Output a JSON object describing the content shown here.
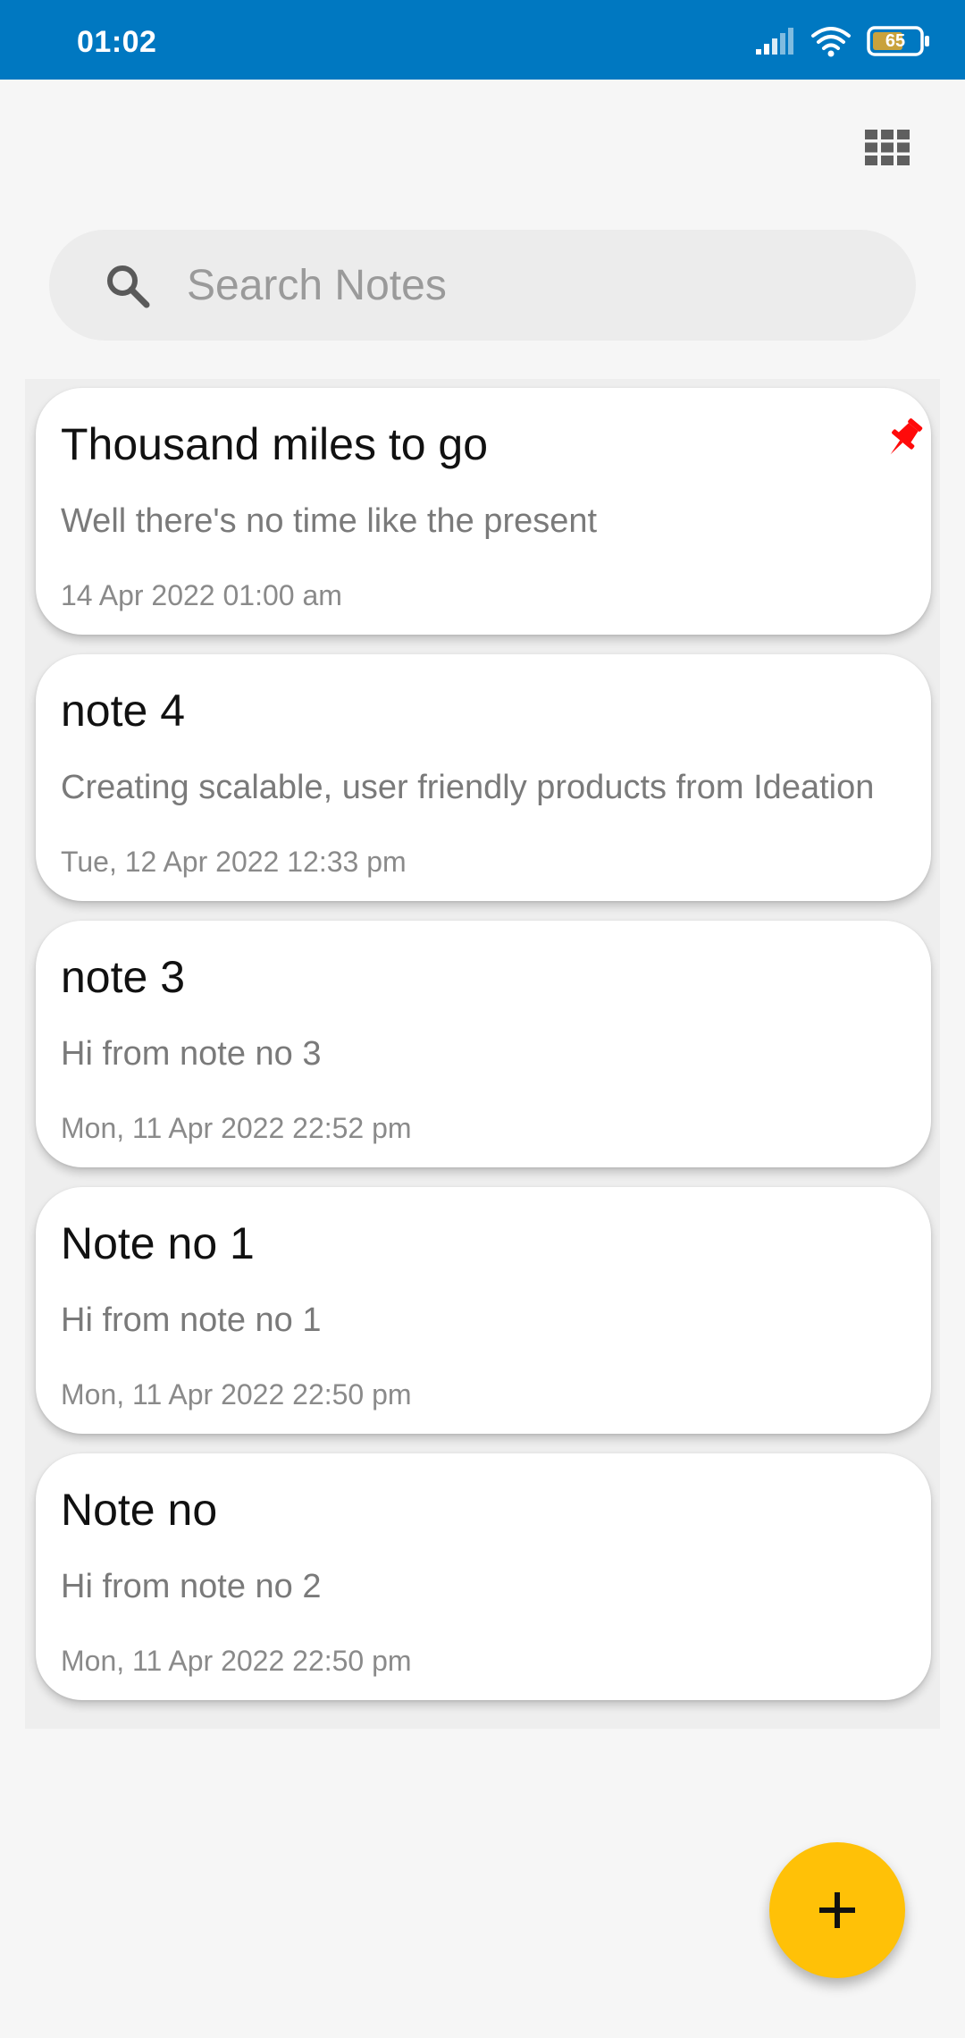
{
  "status_bar": {
    "time": "01:02",
    "battery_level": "65",
    "icons": [
      "signal-icon",
      "wifi-icon",
      "battery-icon"
    ],
    "background_color": "#0078c1"
  },
  "toolbar": {
    "view_toggle_icon": "grid-view-icon"
  },
  "search": {
    "placeholder": "Search Notes",
    "value": "",
    "icon": "search-icon"
  },
  "notes": [
    {
      "title": "Thousand miles to go",
      "body": "Well there's no time like the present",
      "date": "14 Apr 2022 01:00 am",
      "pinned": true,
      "pin_color": "#ff0000"
    },
    {
      "title": "note 4",
      "body": "Creating scalable, user friendly products from Ideation",
      "date": "Tue, 12 Apr 2022 12:33 pm",
      "pinned": false
    },
    {
      "title": "note 3",
      "body": "Hi from note no 3",
      "date": "Mon, 11 Apr 2022 22:52 pm",
      "pinned": false
    },
    {
      "title": "Note no 1",
      "body": "Hi from note no 1",
      "date": "Mon, 11 Apr 2022 22:50 pm",
      "pinned": false
    },
    {
      "title": "Note no",
      "body": "Hi from note no 2",
      "date": "Mon, 11 Apr 2022 22:50 pm",
      "pinned": false
    }
  ],
  "fab": {
    "icon": "plus-icon",
    "color": "#ffc107"
  }
}
